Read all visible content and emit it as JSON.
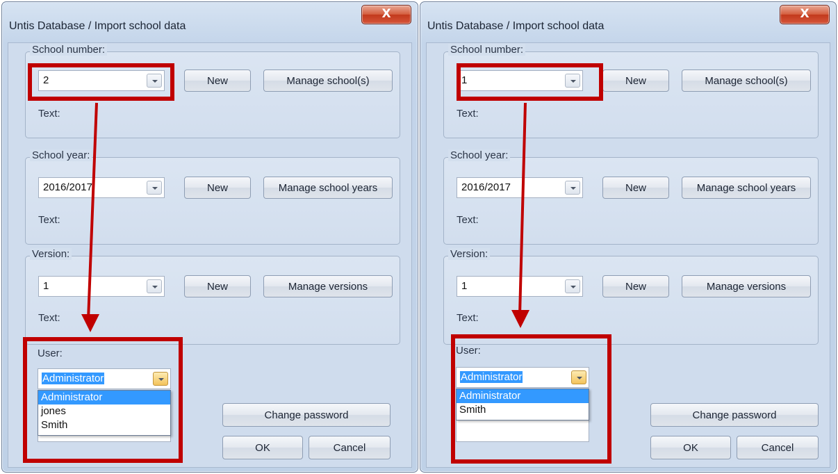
{
  "dialogs": [
    {
      "title": "Untis Database / Import school data",
      "close_label": "X",
      "school_number": {
        "label": "School number:",
        "value": "2",
        "text_label": "Text:"
      },
      "school_year": {
        "label": "School year:",
        "value": "2016/2017",
        "text_label": "Text:"
      },
      "version": {
        "label": "Version:",
        "value": "1",
        "text_label": "Text:"
      },
      "user": {
        "label": "User:",
        "value": "Administrator",
        "options": [
          "Administrator",
          "jones",
          "Smith"
        ]
      },
      "buttons": {
        "new": "New",
        "manage_schools": "Manage school(s)",
        "manage_years": "Manage school years",
        "manage_versions": "Manage versions",
        "change_password": "Change password",
        "ok": "OK",
        "cancel": "Cancel"
      }
    },
    {
      "title": "Untis Database / Import school data",
      "close_label": "X",
      "school_number": {
        "label": "School number:",
        "value": "1",
        "text_label": "Text:"
      },
      "school_year": {
        "label": "School year:",
        "value": "2016/2017",
        "text_label": "Text:"
      },
      "version": {
        "label": "Version:",
        "value": "1",
        "text_label": "Text:"
      },
      "user": {
        "label": "User:",
        "value": "Administrator",
        "options": [
          "Administrator",
          "Smith"
        ]
      },
      "buttons": {
        "new": "New",
        "manage_schools": "Manage school(s)",
        "manage_years": "Manage school years",
        "manage_versions": "Manage versions",
        "change_password": "Change password",
        "ok": "OK",
        "cancel": "Cancel"
      }
    }
  ],
  "colors": {
    "highlight_red": "#c00000",
    "selection_blue": "#3399ff"
  },
  "icons": {
    "close": "close-icon",
    "dropdown": "chevron-down-icon"
  }
}
